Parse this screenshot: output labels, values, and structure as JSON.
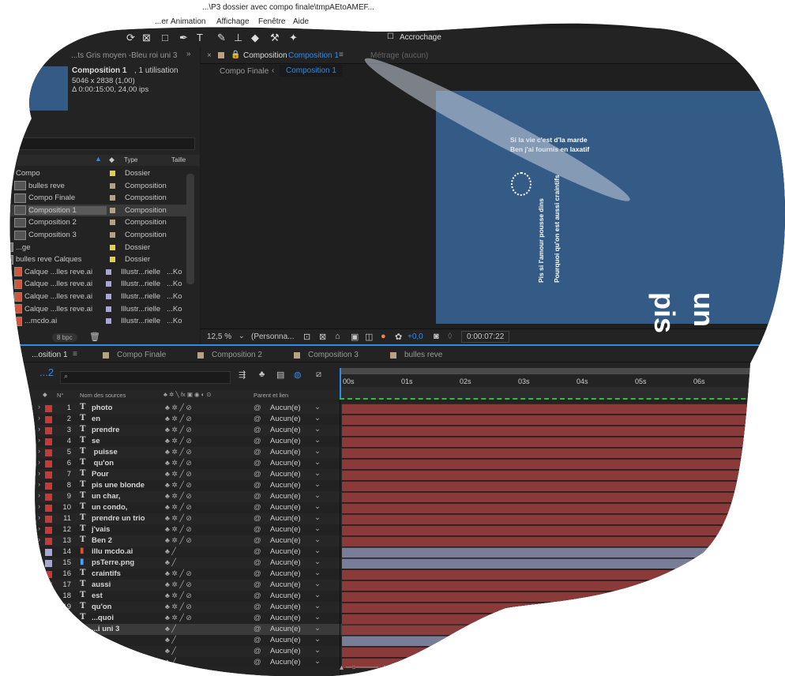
{
  "window": {
    "title": "...\\P3 dossier avec compo finale\\tmpAEtoAMEF..."
  },
  "menubar": {
    "items": [
      "...er",
      "Animation",
      "Affichage",
      "Fenêtre",
      "Aide"
    ]
  },
  "toolbar": {
    "accrochage": "Accrochage"
  },
  "project": {
    "header_tab": "...ts  Gris moyen -Bleu roi uni 3",
    "comp_name": "Composition 1",
    "comp_usage": ", 1 utilisation",
    "comp_size": "5046 x 2838 (1,00)",
    "comp_duration": "Δ 0:00:15:00, 24,00 ips",
    "col_name": "Nom",
    "col_type": "Type",
    "col_size": "Taille",
    "items": [
      {
        "name": "Compo",
        "type": "Dossier",
        "size": "",
        "color": "#e0d04a",
        "kind": "folder"
      },
      {
        "name": "bulles reve",
        "type": "Composition",
        "size": "",
        "color": "#b6a283",
        "kind": "comp"
      },
      {
        "name": "Compo Finale",
        "type": "Composition",
        "size": "",
        "color": "#b6a283",
        "kind": "comp"
      },
      {
        "name": "Composition 1",
        "type": "Composition",
        "size": "",
        "color": "#b6a283",
        "kind": "comp",
        "selected": true
      },
      {
        "name": "Composition 2",
        "type": "Composition",
        "size": "",
        "color": "#b6a283",
        "kind": "comp"
      },
      {
        "name": "Composition 3",
        "type": "Composition",
        "size": "",
        "color": "#b6a283",
        "kind": "comp"
      },
      {
        "name": "...ge",
        "type": "Dossier",
        "size": "",
        "color": "#e0d04a",
        "kind": "folder"
      },
      {
        "name": "bulles reve Calques",
        "type": "Dossier",
        "size": "",
        "color": "#e0d04a",
        "kind": "folder"
      },
      {
        "name": "Calque ...lles reve.ai",
        "type": "Illustr...rielle",
        "size": "...Ko",
        "color": "#a7a7d1",
        "kind": "ai"
      },
      {
        "name": "Calque ...lles reve.ai",
        "type": "Illustr...rielle",
        "size": "...Ko",
        "color": "#a7a7d1",
        "kind": "ai"
      },
      {
        "name": "Calque ...lles reve.ai",
        "type": "Illustr...rielle",
        "size": "...Ko",
        "color": "#a7a7d1",
        "kind": "ai"
      },
      {
        "name": "Calque ...lles reve.ai",
        "type": "Illustr...rielle",
        "size": "...Ko",
        "color": "#a7a7d1",
        "kind": "ai"
      },
      {
        "name": "...mcdo.ai",
        "type": "Illustr...rielle",
        "size": "...Ko",
        "color": "#a7a7d1",
        "kind": "ai"
      }
    ],
    "bpc": "8 bpc"
  },
  "composition_viewer": {
    "tab_label": "Composition",
    "tab_active": "Composition 1",
    "footage_tab": "Métrage  (aucun)",
    "breadcrumb_1": "Compo Finale",
    "breadcrumb_2": "Composition 1",
    "canvas_text_1": "Si la vie c'est d'la marde",
    "canvas_text_2": "Ben j'ai  fournis en laxatif",
    "canvas_text_3": "Pis si l'amour pousse dins",
    "canvas_text_4": "Pourquoi qu'on est aussi craintifs",
    "canvas_big_1": "pis",
    "canvas_big_2": "un",
    "zoom": "12,5 %",
    "resolution": "(Personna...",
    "exposure": "+0,0",
    "timecode": "0:00:07:22"
  },
  "timeline": {
    "tabs": [
      "...osition 1",
      "Compo Finale",
      "Composition 2",
      "Composition 3",
      "bulles reve"
    ],
    "current_time_partial": "...2",
    "col_no": "N°",
    "col_source": "Nom des sources",
    "col_parent": "Parent et lien",
    "ruler": [
      "00s",
      "01s",
      "02s",
      "03s",
      "04s",
      "05s",
      "06s"
    ],
    "layers": [
      {
        "n": "1",
        "name": "photo",
        "type": "T",
        "color": "#c43b3b",
        "bar": "#8b3a3a"
      },
      {
        "n": "2",
        "name": "en",
        "type": "T",
        "color": "#c43b3b",
        "bar": "#8b3a3a"
      },
      {
        "n": "3",
        "name": "prendre",
        "type": "T",
        "color": "#c43b3b",
        "bar": "#8b3a3a"
      },
      {
        "n": "4",
        "name": "se",
        "type": "T",
        "color": "#c43b3b",
        "bar": "#8b3a3a"
      },
      {
        "n": "5",
        "name": " puisse",
        "type": "T",
        "color": "#c43b3b",
        "bar": "#8b3a3a"
      },
      {
        "n": "6",
        "name": " qu'on",
        "type": "T",
        "color": "#c43b3b",
        "bar": "#8b3a3a"
      },
      {
        "n": "7",
        "name": "Pour",
        "type": "T",
        "color": "#c43b3b",
        "bar": "#8b3a3a"
      },
      {
        "n": "8",
        "name": "pis une blonde",
        "type": "T",
        "color": "#c43b3b",
        "bar": "#8b3a3a"
      },
      {
        "n": "9",
        "name": "un char,",
        "type": "T",
        "color": "#c43b3b",
        "bar": "#8b3a3a"
      },
      {
        "n": "10",
        "name": "un condo,",
        "type": "T",
        "color": "#c43b3b",
        "bar": "#8b3a3a"
      },
      {
        "n": "11",
        "name": "prendre un trio",
        "type": "T",
        "color": "#c43b3b",
        "bar": "#8b3a3a"
      },
      {
        "n": "12",
        "name": "j'vais",
        "type": "T",
        "color": "#c43b3b",
        "bar": "#8b3a3a"
      },
      {
        "n": "13",
        "name": "Ben 2",
        "type": "T",
        "color": "#c43b3b",
        "bar": "#8b3a3a"
      },
      {
        "n": "14",
        "name": "illu mcdo.ai",
        "type": "ai",
        "color": "#a7a7d1",
        "bar": "#7a7d98"
      },
      {
        "n": "15",
        "name": "psTerre.png",
        "type": "png",
        "color": "#a7a7d1",
        "bar": "#7a7d98"
      },
      {
        "n": "16",
        "name": "craintifs",
        "type": "T",
        "color": "#c43b3b",
        "bar": "#8b3a3a"
      },
      {
        "n": "17",
        "name": "aussi",
        "type": "T",
        "color": "#c43b3b",
        "bar": "#8b3a3a"
      },
      {
        "n": "18",
        "name": "est",
        "type": "T",
        "color": "#c43b3b",
        "bar": "#8b3a3a"
      },
      {
        "n": "19",
        "name": "qu'on",
        "type": "T",
        "color": "#c43b3b",
        "bar": "#8b3a3a"
      },
      {
        "n": "20",
        "name": "...quoi",
        "type": "T",
        "color": "#c43b3b",
        "bar": "#8b3a3a"
      },
      {
        "n": "21",
        "name": "...i uni 3",
        "type": "solid",
        "color": "#c43b3b",
        "bar": "#8a3d3d"
      },
      {
        "n": "22",
        "name": "",
        "type": "",
        "color": "#c43b3b",
        "bar": "#7a7d98"
      },
      {
        "n": "23",
        "name": "",
        "type": "",
        "color": "#c43b3b",
        "bar": "#8b3a3a"
      },
      {
        "n": "24",
        "name": "",
        "type": "",
        "color": "#c43b3b",
        "bar": "#8b3a3a"
      }
    ],
    "parent_value": "Aucun(e)"
  }
}
